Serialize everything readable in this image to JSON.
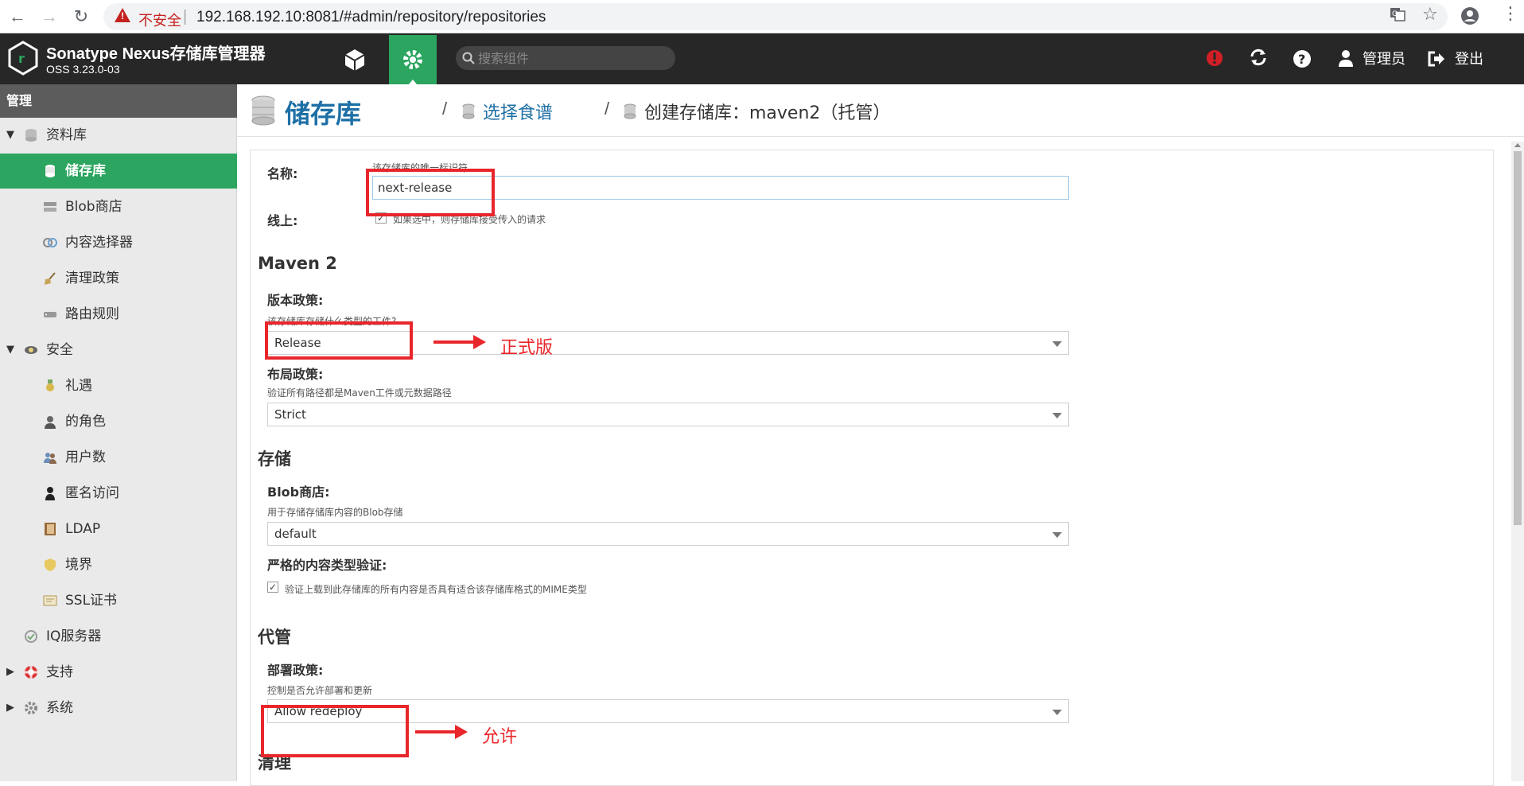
{
  "browser": {
    "insecure_label": "不安全",
    "url": "192.168.192.10:8081/#admin/repository/repositories"
  },
  "header": {
    "title": "Sonatype Nexus存储库管理器",
    "version": "OSS 3.23.0-03",
    "search_placeholder": "搜索组件",
    "user_label": "管理员",
    "logout_label": "登出"
  },
  "sidebar": {
    "title": "管理",
    "items": [
      {
        "label": "资料库"
      },
      {
        "label": "储存库"
      },
      {
        "label": "Blob商店"
      },
      {
        "label": "内容选择器"
      },
      {
        "label": "清理政策"
      },
      {
        "label": "路由规则"
      },
      {
        "label": "安全"
      },
      {
        "label": "礼遇"
      },
      {
        "label": "的角色"
      },
      {
        "label": "用户数"
      },
      {
        "label": "匿名访问"
      },
      {
        "label": "LDAP"
      },
      {
        "label": "境界"
      },
      {
        "label": "SSL证书"
      },
      {
        "label": "IQ服务器"
      },
      {
        "label": "支持"
      },
      {
        "label": "系统"
      }
    ]
  },
  "breadcrumb": {
    "title": "储存库",
    "sep": "/",
    "item2": "选择食谱",
    "item3": "创建存储库：maven2（托管）"
  },
  "form": {
    "name_label": "名称:",
    "name_help": "该存储库的唯一标识符",
    "name_value": "next-release",
    "online_label": "线上:",
    "online_help": "如果选中，则存储库接受传入的请求",
    "maven_section": "Maven 2",
    "version_policy_label": "版本政策:",
    "version_policy_help": "该存储库存储什么类型的工件?",
    "version_policy_value": "Release",
    "layout_policy_label": "布局政策:",
    "layout_policy_help": "验证所有路径都是Maven工件或元数据路径",
    "layout_policy_value": "Strict",
    "storage_section": "存储",
    "blob_label": "Blob商店:",
    "blob_help": "用于存储存储库内容的Blob存储",
    "blob_value": "default",
    "strict_label": "严格的内容类型验证:",
    "strict_help": "验证上载到此存储库的所有内容是否具有适合该存储库格式的MIME类型",
    "hosted_section": "代管",
    "deploy_label": "部署政策:",
    "deploy_help": "控制是否允许部署和更新",
    "deploy_value": "Allow redeploy",
    "cleanup_section": "清理"
  },
  "annotations": {
    "release_note": "正式版",
    "redeploy_note": "允许"
  },
  "colors": {
    "accent_green": "#2ba55f",
    "header_bg": "#272727",
    "link_blue": "#1d6fa5",
    "annotation_red": "#e8262b"
  }
}
